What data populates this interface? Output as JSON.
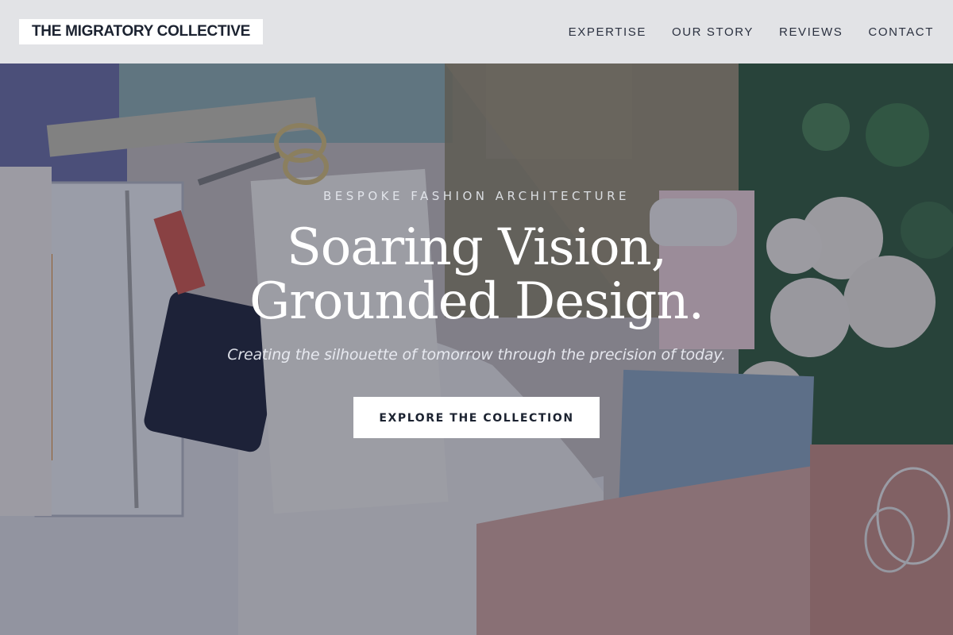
{
  "brand": {
    "name": "THE MIGRATORY COLLECTIVE"
  },
  "nav": {
    "items": [
      {
        "label": "EXPERTISE"
      },
      {
        "label": "OUR STORY"
      },
      {
        "label": "REVIEWS"
      },
      {
        "label": "CONTACT"
      }
    ]
  },
  "hero": {
    "eyebrow": "BESPOKE FASHION ARCHITECTURE",
    "headline_line1": "Soaring Vision,",
    "headline_line2": "Grounded Design.",
    "tagline": "Creating the silhouette of tomorrow through the precision of today.",
    "cta_label": "EXPLORE THE COLLECTION"
  },
  "background": {
    "photo_subject": "flat-lay-fashion-design-workspace-photo"
  },
  "colors": {
    "overlay": "#1e243a",
    "navbar": "#eceef1",
    "button_bg": "#ffffff",
    "text_dark": "#1b2230"
  }
}
